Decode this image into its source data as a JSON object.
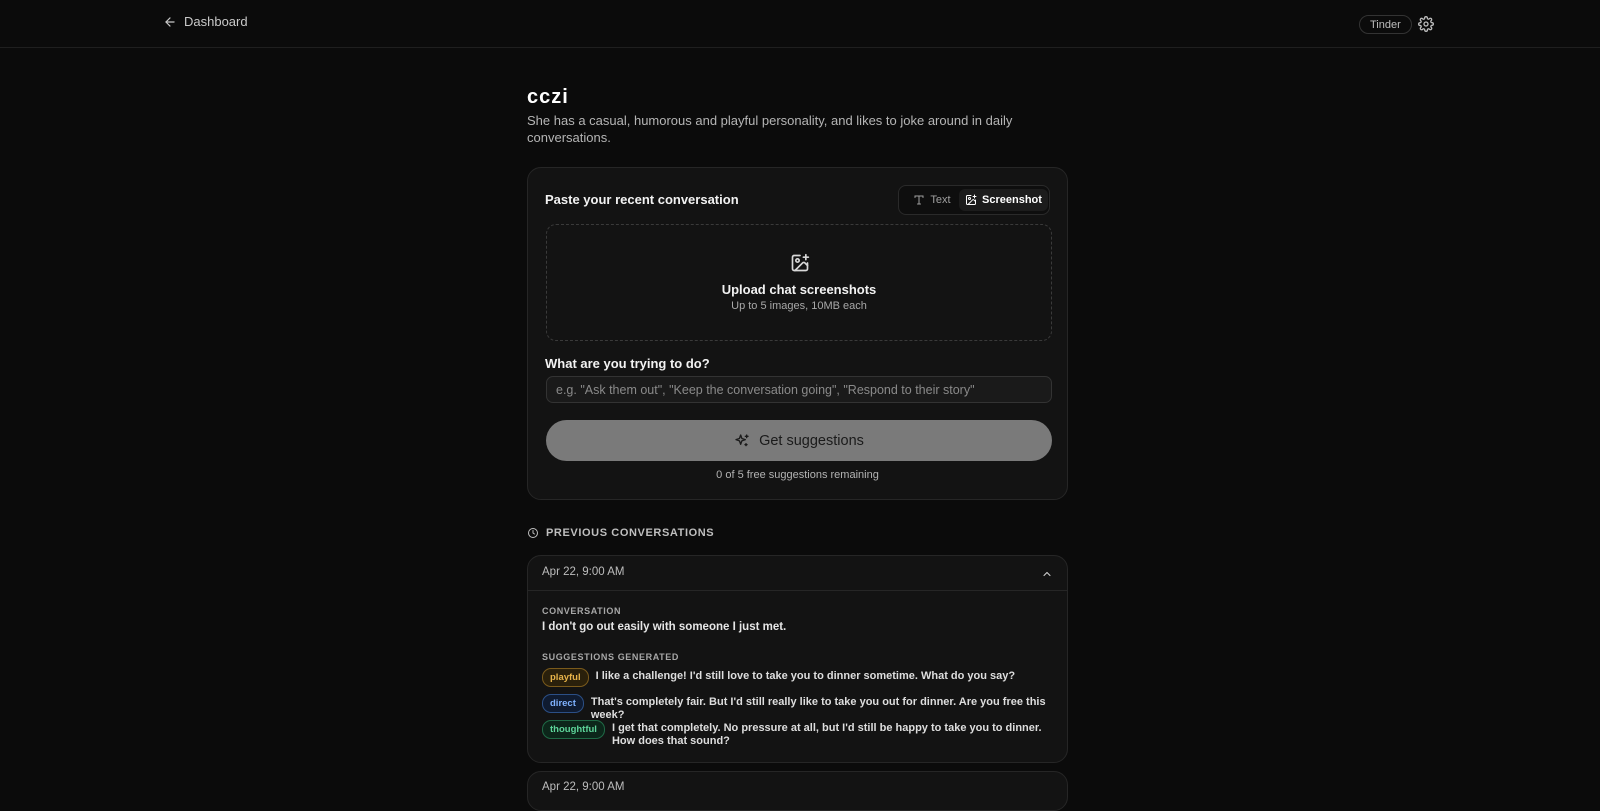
{
  "nav": {
    "back_label": "Dashboard",
    "platform": "Tinder"
  },
  "profile": {
    "name": "cczi",
    "description": "She has a casual, humorous and playful personality, and likes to joke around in daily conversations."
  },
  "composer": {
    "label": "Paste your recent conversation",
    "modes": {
      "text": "Text",
      "screenshot": "Screenshot",
      "selected": "Screenshot"
    },
    "upload": {
      "title": "Upload chat screenshots",
      "subtitle": "Up to 5 images, 10MB each"
    },
    "goal_label": "What are you trying to do?",
    "goal_placeholder": "e.g. \"Ask them out\", \"Keep the conversation going\", \"Respond to their story\"",
    "goal_value": "",
    "submit_label": "Get suggestions",
    "remaining": "0 of 5 free suggestions remaining"
  },
  "history": {
    "heading": "PREVIOUS CONVERSATIONS",
    "items": [
      {
        "date": "Apr 22, 9:00 AM",
        "expanded": true,
        "conversation_label": "CONVERSATION",
        "conversation": "I don't go out easily with someone I just met.",
        "suggestions_label": "SUGGESTIONS GENERATED",
        "suggestions": [
          {
            "tag": "playful",
            "text": "I like a challenge! I'd still love to take you to dinner sometime. What do you say?"
          },
          {
            "tag": "direct",
            "text": "That's completely fair. But I'd still really like to take you out for dinner. Are you free this week?"
          },
          {
            "tag": "thoughtful",
            "text": "I get that completely. No pressure at all, but I'd still be happy to take you to dinner. How does that sound?"
          }
        ]
      },
      {
        "date": "Apr 22, 9:00 AM",
        "expanded": false
      }
    ]
  },
  "colors": {
    "background": "#0b0b0b",
    "card": "#131313",
    "cta": "#7a7a7a",
    "tag_playful": "#e8b44a",
    "tag_direct": "#7fb2ff",
    "tag_thoughtful": "#5ed59a"
  },
  "icons": {
    "back": "arrow-left-icon",
    "settings": "gear-icon",
    "text_mode": "text-type-icon",
    "screenshot_mode": "image-plus-icon",
    "upload": "image-plus-icon",
    "cta": "sparkles-icon",
    "history": "clock-icon",
    "collapse": "chevron-up-icon"
  }
}
